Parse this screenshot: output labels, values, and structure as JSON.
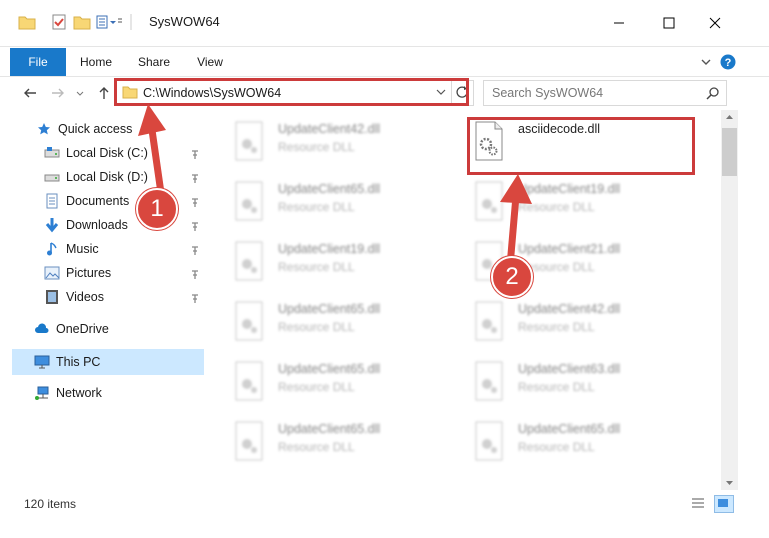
{
  "window": {
    "title": "SysWOW64"
  },
  "ribbon": {
    "tabs": [
      {
        "label": "File"
      },
      {
        "label": "Home"
      },
      {
        "label": "Share"
      },
      {
        "label": "View"
      }
    ]
  },
  "address": {
    "path": "C:\\Windows\\SysWOW64"
  },
  "search": {
    "placeholder": "Search SysWOW64"
  },
  "sidebar": {
    "quick_access": "Quick access",
    "items": [
      {
        "label": "Local Disk (C:)"
      },
      {
        "label": "Local Disk (D:)"
      },
      {
        "label": "Documents"
      },
      {
        "label": "Downloads"
      },
      {
        "label": "Music"
      },
      {
        "label": "Pictures"
      },
      {
        "label": "Videos"
      }
    ],
    "onedrive": "OneDrive",
    "this_pc": "This PC",
    "network": "Network"
  },
  "files": {
    "left": [
      {
        "name": "UpdateClient42.dll",
        "type": "Resource DLL"
      },
      {
        "name": "UpdateClient65.dll",
        "type": "Resource DLL"
      },
      {
        "name": "UpdateClient19.dll",
        "type": "Resource DLL"
      },
      {
        "name": "UpdateClient65.dll",
        "type": "Resource DLL"
      },
      {
        "name": "UpdateClient65.dll",
        "type": "Resource DLL"
      },
      {
        "name": "UpdateClient65.dll",
        "type": "Resource DLL"
      }
    ],
    "right": [
      {
        "name": "asciidecode.dll",
        "type": ""
      },
      {
        "name": "UpdateClient19.dll",
        "type": "Resource DLL"
      },
      {
        "name": "UpdateClient21.dll",
        "type": "Resource DLL"
      },
      {
        "name": "UpdateClient42.dll",
        "type": "Resource DLL"
      },
      {
        "name": "UpdateClient63.dll",
        "type": "Resource DLL"
      },
      {
        "name": "UpdateClient65.dll",
        "type": "Resource DLL"
      }
    ]
  },
  "status": {
    "item_count": "120 items"
  },
  "annotations": {
    "step1": "1",
    "step2": "2"
  },
  "colors": {
    "accent": "#1979ca",
    "highlight": "#cc3b3b",
    "badge": "#d9473e",
    "selected": "#cce8ff"
  }
}
